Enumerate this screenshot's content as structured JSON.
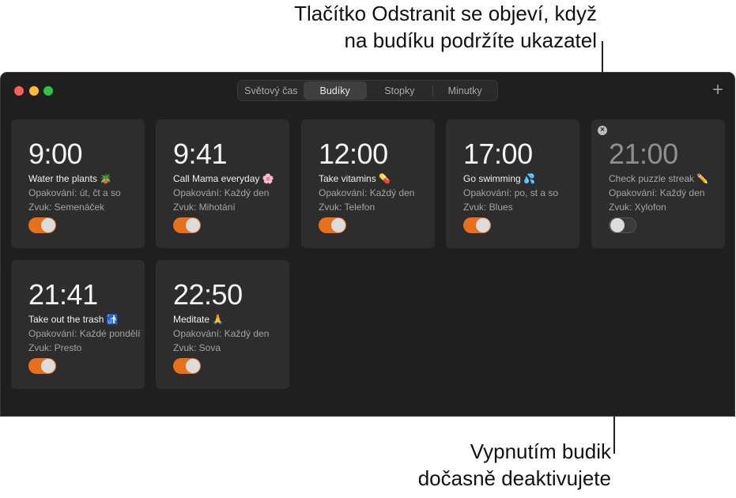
{
  "callouts": {
    "top_line1": "Tlačítko Odstranit se objeví, když",
    "top_line2": "na budíku podržíte ukazatel",
    "bottom_line1": "Vypnutím budik",
    "bottom_line2": "dočasně deaktivujete"
  },
  "window": {
    "tabs": [
      "Světový čas",
      "Budíky",
      "Stopky",
      "Minutky"
    ],
    "selected_tab": "Budíky",
    "add_icon": "+"
  },
  "alarms": [
    {
      "time": "9:00",
      "label": "Water the plants 🪴",
      "repeat": "Opakování: út, čt a so",
      "sound": "Zvuk: Semenáček",
      "enabled": true
    },
    {
      "time": "9:41",
      "label": "Call Mama everyday 🌸",
      "repeat": "Opakování: Každý den",
      "sound": "Zvuk: Mihotání",
      "enabled": true
    },
    {
      "time": "12:00",
      "label": "Take vitamins 💊",
      "repeat": "Opakování: Každý den",
      "sound": "Zvuk: Telefon",
      "enabled": true
    },
    {
      "time": "17:00",
      "label": "Go swimming 💦",
      "repeat": "Opakování: po, st a so",
      "sound": "Zvuk: Blues",
      "enabled": true
    },
    {
      "time": "21:00",
      "label": "Check puzzle streak ✏️",
      "repeat": "Opakování: Každý den",
      "sound": "Zvuk: Xylofon",
      "enabled": false,
      "delete_icon": "×"
    },
    {
      "time": "21:41",
      "label": "Take out the trash 🚮",
      "repeat": "Opakování: Každé pondělí",
      "sound": "Zvuk: Presto",
      "enabled": true
    },
    {
      "time": "22:50",
      "label": "Meditate 🙏",
      "repeat": "Opakování: Každý den",
      "sound": "Zvuk: Sova",
      "enabled": true
    }
  ],
  "colors": {
    "accent_toggle": "#e8701a",
    "window_bg": "#1f1f1f",
    "card_bg": "#2d2d2d"
  }
}
